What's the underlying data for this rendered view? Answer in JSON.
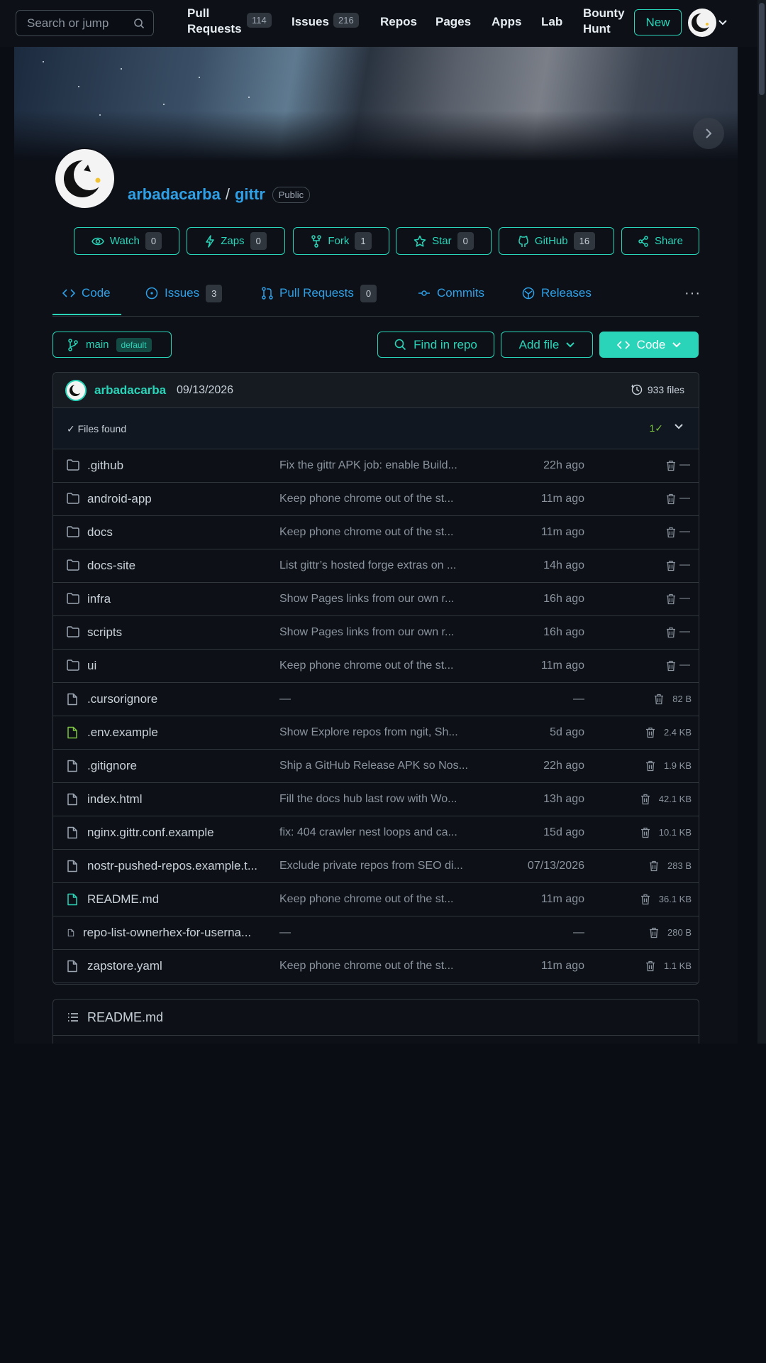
{
  "nav": {
    "search_placeholder": "Search or jump",
    "items": [
      {
        "label": "Pull Requests",
        "badge": "114"
      },
      {
        "label": "Issues",
        "badge": "216"
      },
      {
        "label": "Repos"
      },
      {
        "label": "Pages"
      },
      {
        "label": "Apps"
      },
      {
        "label": "Lab"
      },
      {
        "label": "Bounty Hunt"
      }
    ],
    "new_label": "New"
  },
  "repo": {
    "owner": "arbadacarba",
    "separator": "/",
    "name": "gittr",
    "visibility": "Public"
  },
  "actions": [
    {
      "label": "Watch",
      "count": "0",
      "icon": "eye-icon"
    },
    {
      "label": "Zaps",
      "count": "0",
      "icon": "zap-icon"
    },
    {
      "label": "Fork",
      "count": "1",
      "icon": "fork-icon"
    },
    {
      "label": "Star",
      "count": "0",
      "icon": "star-icon"
    },
    {
      "label": "GitHub",
      "count": "16",
      "icon": "github-icon"
    },
    {
      "label": "Share",
      "icon": "share-icon"
    }
  ],
  "tabs": [
    {
      "label": "Code",
      "icon": "code-icon"
    },
    {
      "label": "Issues",
      "count": "3",
      "icon": "issue-icon"
    },
    {
      "label": "Pull Requests",
      "count": "0",
      "icon": "pull-request-icon"
    },
    {
      "label": "Commits",
      "icon": "commit-icon"
    },
    {
      "label": "Releases",
      "icon": "release-icon"
    }
  ],
  "tabs_more": "···",
  "branch": {
    "name": "main",
    "badge": "default"
  },
  "buttons": {
    "find": "Find in repo",
    "add_file": "Add file",
    "code": "Code"
  },
  "commit": {
    "author": "arbadacarba",
    "date": "09/13/2026",
    "file_count": "933 files"
  },
  "files_found": {
    "label": "✓ Files found",
    "count": "1✓"
  },
  "files": [
    {
      "type": "dir",
      "name": ".github",
      "message": "Fix the gittr APK job: enable Build...",
      "time": "22h ago",
      "size": "—"
    },
    {
      "type": "dir",
      "name": "android-app",
      "message": "Keep phone chrome out of the st...",
      "time": "11m ago",
      "size": "—"
    },
    {
      "type": "dir",
      "name": "docs",
      "message": "Keep phone chrome out of the st...",
      "time": "11m ago",
      "size": "—"
    },
    {
      "type": "dir",
      "name": "docs-site",
      "message": "List gittr’s hosted forge extras on ...",
      "time": "14h ago",
      "size": "—"
    },
    {
      "type": "dir",
      "name": "infra",
      "message": "Show Pages links from our own r...",
      "time": "16h ago",
      "size": "—"
    },
    {
      "type": "dir",
      "name": "scripts",
      "message": "Show Pages links from our own r...",
      "time": "16h ago",
      "size": "—"
    },
    {
      "type": "dir",
      "name": "ui",
      "message": "Keep phone chrome out of the st...",
      "time": "11m ago",
      "size": "—"
    },
    {
      "type": "file",
      "name": ".cursorignore",
      "message": "—",
      "time": "—",
      "size": "82 B"
    },
    {
      "type": "file-env",
      "name": ".env.example",
      "message": "Show Explore repos from ngit, Sh...",
      "time": "5d ago",
      "size": "2.4 KB"
    },
    {
      "type": "file",
      "name": ".gitignore",
      "message": "Ship a GitHub Release APK so Nos...",
      "time": "22h ago",
      "size": "1.9 KB"
    },
    {
      "type": "file",
      "name": "index.html",
      "message": "Fill the docs hub last row with Wo...",
      "time": "13h ago",
      "size": "42.1 KB"
    },
    {
      "type": "file",
      "name": "nginx.gittr.conf.example",
      "message": "fix: 404 crawler nest loops and ca...",
      "time": "15d ago",
      "size": "10.1 KB"
    },
    {
      "type": "file",
      "name": "nostr-pushed-repos.example.t...",
      "message": "Exclude private repos from SEO di...",
      "time": "07/13/2026",
      "size": "283 B"
    },
    {
      "type": "file-md",
      "name": "README.md",
      "message": "Keep phone chrome out of the st...",
      "time": "11m ago",
      "size": "36.1 KB"
    },
    {
      "type": "file-small",
      "name": "repo-list-ownerhex-for-userna...",
      "message": "—",
      "time": "—",
      "size": "280 B"
    },
    {
      "type": "file",
      "name": "zapstore.yaml",
      "message": "Keep phone chrome out of the st...",
      "time": "11m ago",
      "size": "1.1 KB"
    }
  ],
  "readme": {
    "title": "README.md"
  },
  "colors": {
    "accent": "#2ad4b8",
    "link": "#2f9fe6",
    "background": "#0a0d14",
    "surface": "#0d1117",
    "border": "#30363d"
  }
}
